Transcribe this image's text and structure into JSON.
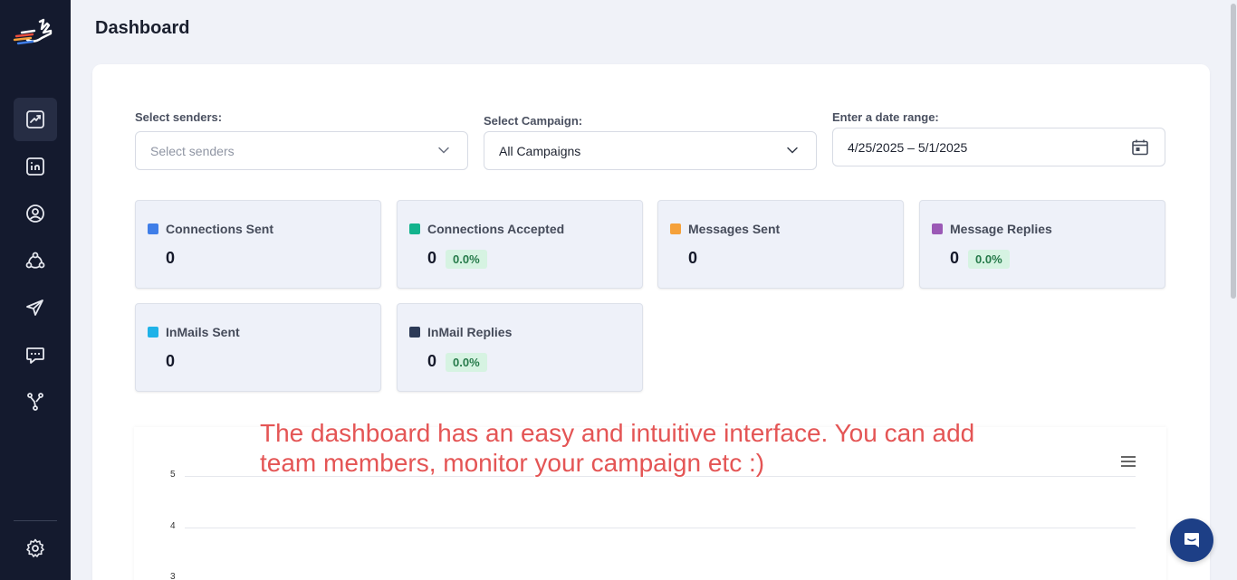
{
  "header": {
    "title": "Dashboard"
  },
  "sidebar": {
    "items": [
      {
        "icon": "chart-trend-icon",
        "active": true
      },
      {
        "icon": "linkedin-icon",
        "active": false
      },
      {
        "icon": "user-circle-icon",
        "active": false
      },
      {
        "icon": "network-icon",
        "active": false
      },
      {
        "icon": "send-icon",
        "active": false
      },
      {
        "icon": "message-icon",
        "active": false
      },
      {
        "icon": "workflow-icon",
        "active": false
      }
    ],
    "bottom_icon": "gear-icon"
  },
  "filters": {
    "senders": {
      "label": "Select senders:",
      "placeholder": "Select senders"
    },
    "campaign": {
      "label": "Select Campaign:",
      "value": "All Campaigns"
    },
    "date": {
      "label": "Enter a date range:",
      "value": "4/25/2025 – 5/1/2025"
    }
  },
  "stats": [
    {
      "label": "Connections Sent",
      "value": "0",
      "color": "#3f7ee8",
      "badge": ""
    },
    {
      "label": "Connections Accepted",
      "value": "0",
      "color": "#13b38d",
      "badge": "0.0%"
    },
    {
      "label": "Messages Sent",
      "value": "0",
      "color": "#f5a13a",
      "badge": ""
    },
    {
      "label": "Message Replies",
      "value": "0",
      "color": "#9b59b6",
      "badge": "0.0%"
    },
    {
      "label": "InMails Sent",
      "value": "0",
      "color": "#1fb2e8",
      "badge": ""
    },
    {
      "label": "InMail Replies",
      "value": "0",
      "color": "#2c3a57",
      "badge": "0.0%"
    }
  ],
  "chart": {
    "yticks": [
      "5",
      "4",
      "3"
    ]
  },
  "overlay_text": {
    "line1": "The dashboard has an easy and intuitive interface. You can add",
    "line2": "team members, monitor your campaign etc  :)"
  }
}
